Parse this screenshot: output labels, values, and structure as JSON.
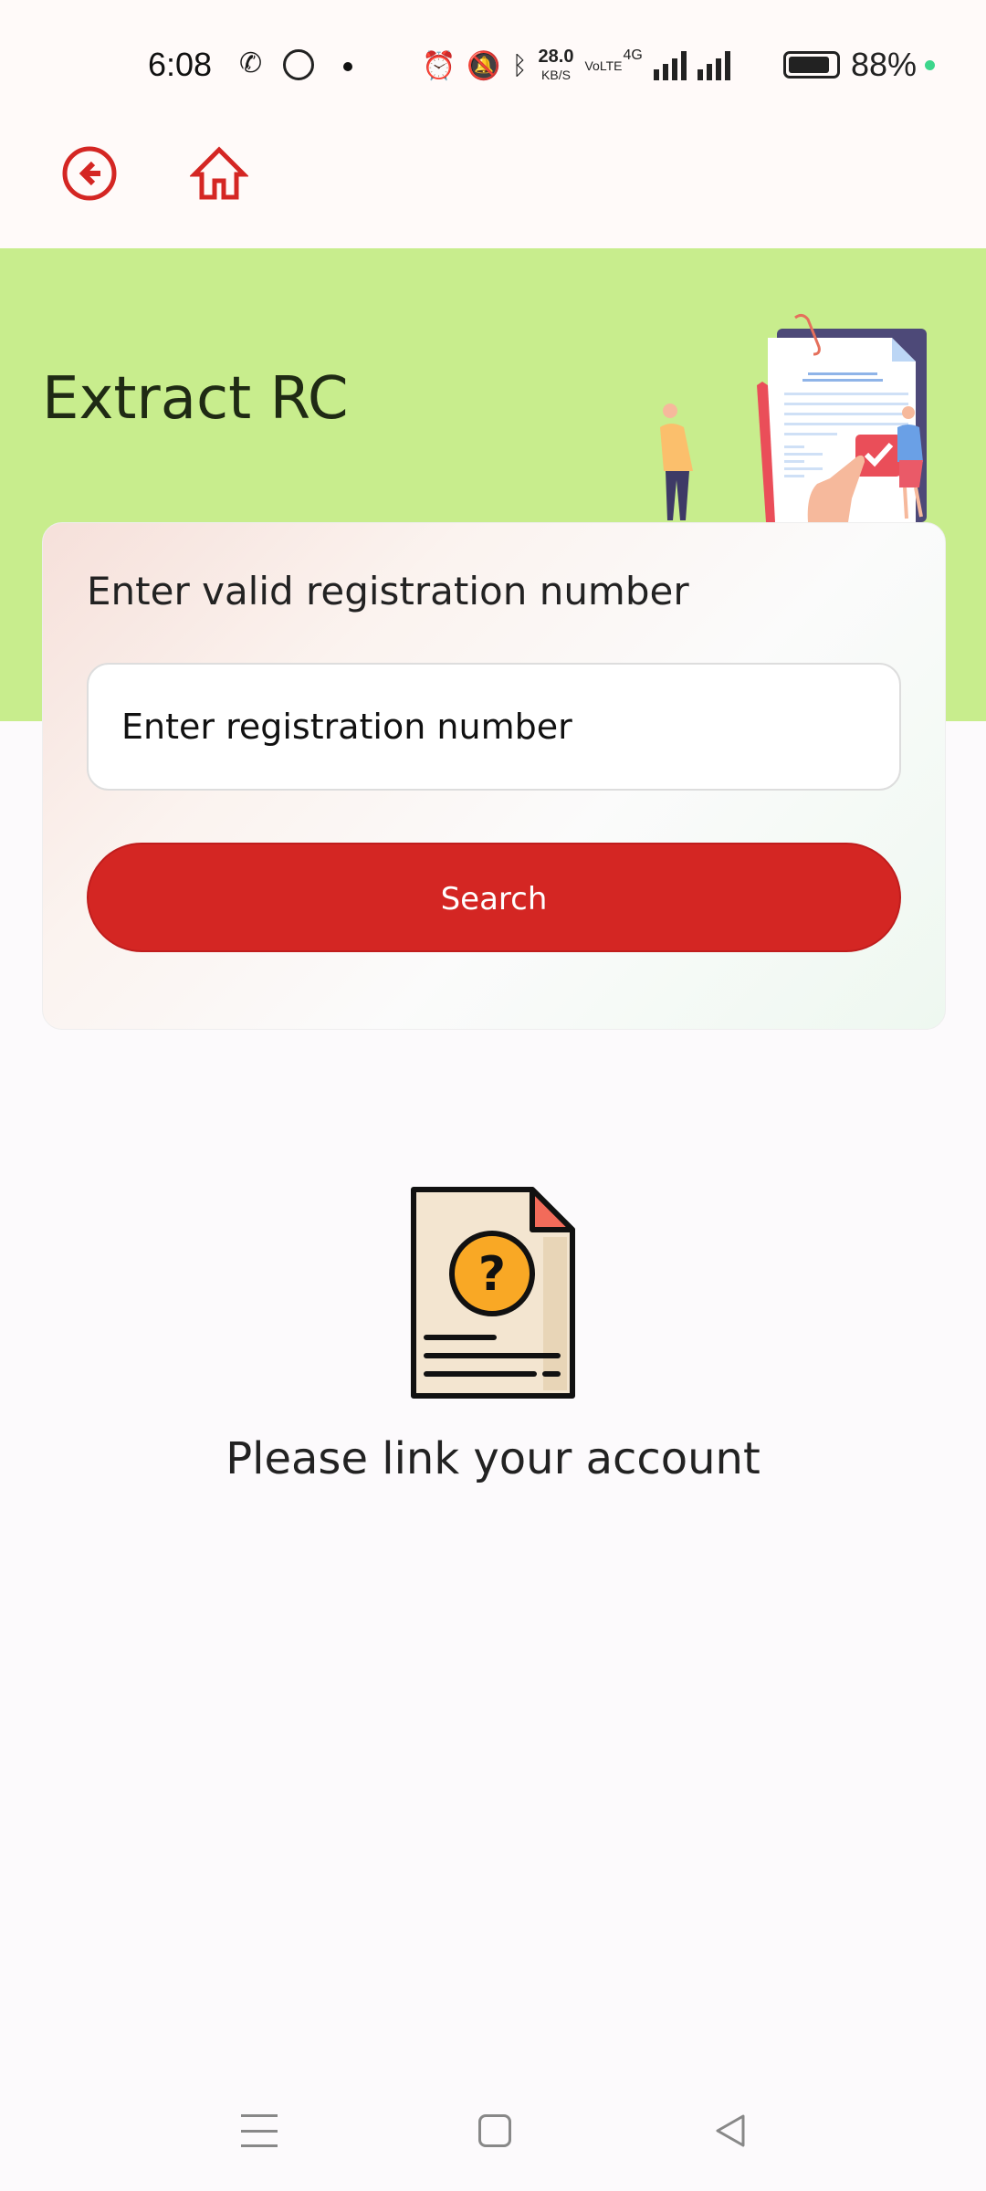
{
  "status_bar": {
    "time": "6:08",
    "network_speed": "28.0",
    "network_speed_unit": "KB/S",
    "network_type": "4G",
    "battery_percent": "88%",
    "battery_level": 0.88
  },
  "toolbar": {
    "back_icon": "circle-arrow-left-icon",
    "home_icon": "home-icon",
    "accent_color": "#d42623"
  },
  "header": {
    "title": "Extract RC",
    "banner_color": "#c8ed8d"
  },
  "form": {
    "label": "Enter valid registration number",
    "input_placeholder": "Enter registration number",
    "input_value": "",
    "search_label": "Search"
  },
  "empty_state": {
    "icon": "document-question-icon",
    "message": "Please link your account"
  },
  "nav_bar": {
    "menu_icon": "menu-icon",
    "home_icon": "square-home-icon",
    "back_icon": "triangle-back-icon"
  }
}
